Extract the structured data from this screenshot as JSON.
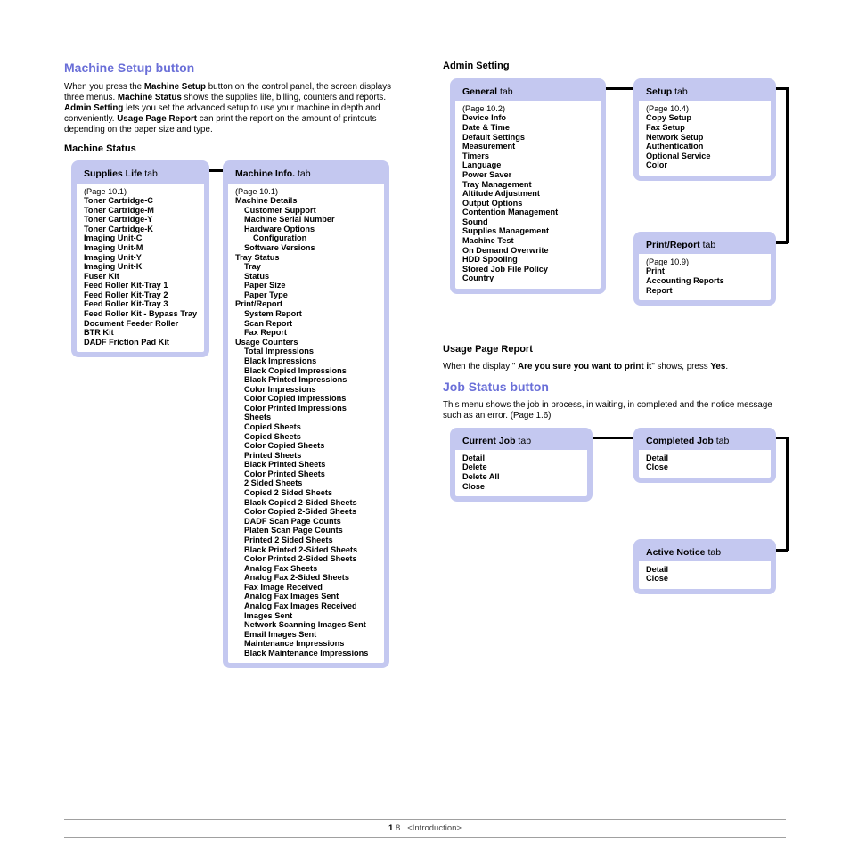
{
  "left": {
    "h2": "Machine Setup button",
    "p1a": "When you press the ",
    "p1b": "Machine Setup",
    "p1c": " button on the control panel, the screen displays three menus. ",
    "p1d": "Machine Status",
    "p1e": " shows the supplies life, billing, counters and reports. ",
    "p1f": "Admin Setting",
    "p1g": " lets you set the advanced setup to use your machine in depth and conveniently. ",
    "p1h": "Usage Page Report",
    "p1i": " can print the report on the amount of printouts depending on the paper size and type.",
    "h3": "Machine Status",
    "supplies": {
      "title_b": "Supplies Life",
      "title_t": " tab",
      "ref": "(Page 10.1)",
      "items": [
        "Toner Cartridge-C",
        "Toner Cartridge-M",
        "Toner Cartridge-Y",
        "Toner Cartridge-K",
        "Imaging Unit-C",
        "Imaging Unit-M",
        "Imaging Unit-Y",
        "Imaging Unit-K",
        "Fuser Kit",
        "Feed Roller Kit-Tray 1",
        "Feed Roller Kit-Tray 2",
        "Feed Roller Kit-Tray 3",
        "Feed Roller Kit - Bypass Tray",
        "Document Feeder Roller",
        "BTR Kit",
        "DADF Friction Pad Kit"
      ]
    },
    "machine": {
      "title_b": "Machine Info.",
      "title_t": " tab",
      "ref": "(Page 10.1)",
      "s1": "Machine Details",
      "s1_items": [
        "Customer Support",
        "Machine Serial Number",
        "Hardware Options Configuration",
        "Software Versions"
      ],
      "s2": "Tray Status",
      "s2_items": [
        "Tray",
        "Status",
        "Paper Size",
        "Paper Type"
      ],
      "s3": "Print/Report",
      "s3_items": [
        "System Report",
        "Scan Report",
        "Fax Report"
      ],
      "s4": "Usage Counters",
      "s4_items": [
        "Total Impressions",
        "Black Impressions",
        "Black Copied Impressions",
        "Black Printed Impressions",
        "Color Impressions",
        "Color Copied Impressions",
        "Color Printed Impressions",
        "Sheets",
        "Copied Sheets",
        "Copied Sheets",
        "Color Copied Sheets",
        "Printed Sheets",
        "Black Printed Sheets",
        "Color Printed Sheets",
        "2 Sided Sheets",
        "Copied 2 Sided Sheets",
        "Black Copied 2-Sided Sheets",
        "Color Copied 2-Sided Sheets",
        "DADF Scan Page Counts",
        "Platen Scan Page Counts",
        "Printed 2 Sided Sheets",
        "Black Printed 2-Sided Sheets",
        "Color Printed 2-Sided Sheets",
        "Analog Fax Sheets",
        "Analog Fax 2-Sided Sheets",
        "Fax Image Received",
        "Analog Fax Images Sent",
        "Analog Fax Images Received",
        "Images Sent",
        "Network Scanning Images Sent",
        "Email Images Sent",
        "Maintenance Impressions",
        "Black Maintenance Impressions"
      ]
    }
  },
  "right": {
    "h3a": "Admin Setting",
    "general": {
      "title_b": "General",
      "title_t": " tab",
      "ref": "(Page 10.2)",
      "items": [
        "Device Info",
        "Date & Time",
        "Default Settings",
        "Measurement",
        "Timers",
        "Language",
        "Power Saver",
        "Tray Management",
        "Altitude Adjustment",
        "Output Options",
        "Contention Management",
        "Sound",
        "Supplies Management",
        "Machine Test",
        "On Demand Overwrite",
        "HDD Spooling",
        "Stored Job File Policy",
        "Country"
      ]
    },
    "setup": {
      "title_b": "Setup",
      "title_t": " tab",
      "ref": "(Page 10.4)",
      "items": [
        "Copy Setup",
        "Fax Setup",
        "Network Setup",
        "Authentication",
        "Optional Service",
        "Color"
      ]
    },
    "printreport": {
      "title_b": "Print/Report",
      "title_t": " tab",
      "ref": "(Page 10.9)",
      "items": [
        "Print",
        "Accounting Reports",
        "Report"
      ]
    },
    "h3b": "Usage Page Report",
    "upr_a": "When the display  \" ",
    "upr_b": "Are you sure you want to print it",
    "upr_c": "\" shows, press ",
    "upr_d": "Yes",
    "upr_e": ".",
    "h2b": "Job Status button",
    "jsp1": "This menu shows the job in process, in waiting, in completed and the notice message such as an error. (Page 1.6)",
    "current": {
      "title_b": "Current Job",
      "title_t": " tab",
      "items": [
        "Detail",
        "Delete",
        "Delete All",
        "Close"
      ]
    },
    "completed": {
      "title_b": "Completed Job",
      "title_t": " tab",
      "items": [
        "Detail",
        "Close"
      ]
    },
    "active": {
      "title_b": "Active Notice",
      "title_t": " tab",
      "items": [
        "Detail",
        "Close"
      ]
    }
  },
  "footer": {
    "chapter": "1",
    "dot": ".",
    "page": "8",
    "label": "<Introduction>"
  }
}
